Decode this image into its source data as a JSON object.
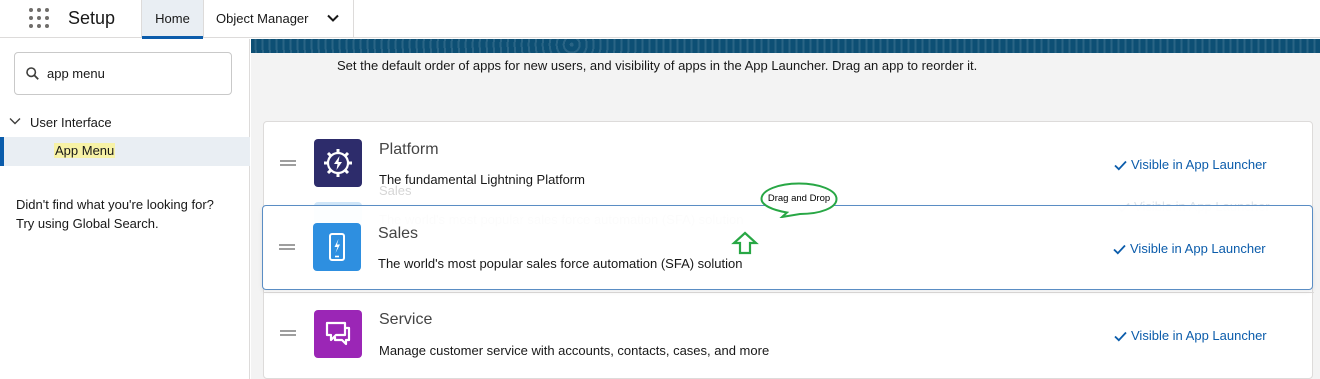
{
  "header": {
    "app_launcher_icon": "waffle-icon",
    "title": "Setup",
    "tabs": [
      {
        "label": "Home",
        "active": true
      },
      {
        "label": "Object Manager",
        "active": false,
        "icon": "chevron-down-icon"
      }
    ]
  },
  "sidebar": {
    "search": {
      "value": "app menu",
      "icon": "search-icon"
    },
    "tree": {
      "parent_label": "User Interface",
      "child_label": "App Menu"
    },
    "help_line1": "Didn't find what you're looking for?",
    "help_line2": "Try using Global Search."
  },
  "main": {
    "description": "Set the default order of apps for new users, and visibility of apps in the App Launcher. Drag an app to reorder it.",
    "apps": [
      {
        "name": "Platform",
        "description": "The fundamental Lightning Platform",
        "visibility": "Visible in App Launcher",
        "icon": "lightning-gear-icon",
        "color": "#2d2c6b"
      },
      {
        "name": "Sales",
        "description": "The world's most popular sales force automation (SFA) solution",
        "visibility": "Visible in App Launcher",
        "icon": "mobile-lightning-icon",
        "color": "#2e8fe0"
      },
      {
        "name": "Service",
        "description": "Manage customer service with accounts, contacts, cases, and more",
        "visibility": "Visible in App Launcher",
        "icon": "chat-bubbles-icon",
        "color": "#9b26b6"
      }
    ],
    "annotation": {
      "text": "Drag and Drop",
      "color": "#28a745"
    }
  },
  "colors": {
    "brand": "#0b5cab",
    "banner": "#0d4f74"
  }
}
